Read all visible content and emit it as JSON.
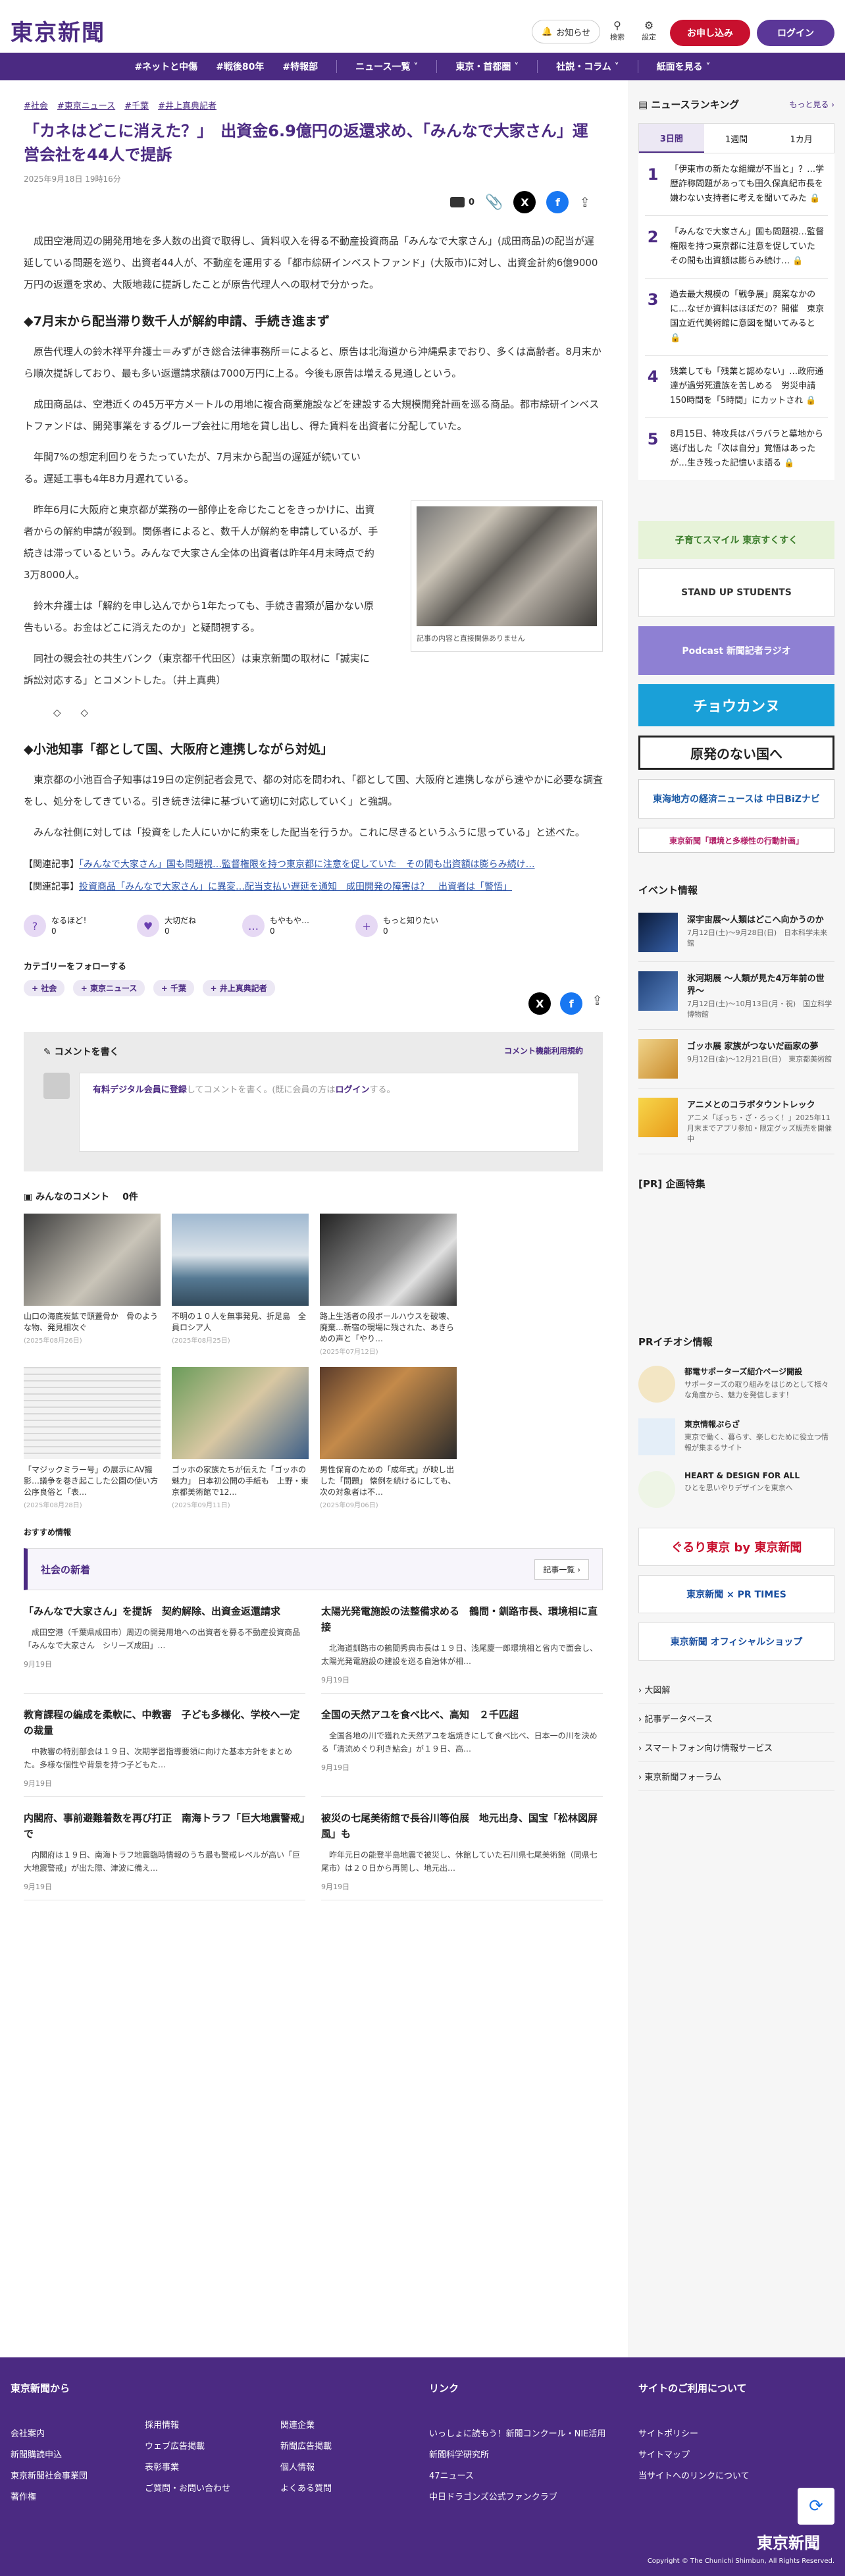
{
  "header": {
    "logo": "東京新聞",
    "notify_label": "お知らせ",
    "search_label": "検索",
    "settings_label": "設定",
    "subscribe_label": "お申し込み",
    "login_label": "ログイン"
  },
  "nav": [
    "#ネットと中傷",
    "#戦後80年",
    "#特報部",
    "ニュース一覧",
    "東京・首都圏",
    "社説・コラム",
    "紙面を見る"
  ],
  "article": {
    "tags": [
      "#社会",
      "#東京ニュース",
      "#千葉",
      "#井上真典記者"
    ],
    "title": "「カネはどこに消えた？」　出資金6.9億円の返還求め、「みんなで大家さん」運営会社を44人で提訴",
    "date": "2025年9月18日 19時16分",
    "save_count": "0",
    "p1": "成田空港周辺の開発用地を多人数の出資で取得し、賃料収入を得る不動産投資商品「みんなで大家さん」(成田商品)の配当が遅延している問題を巡り、出資者44人が、不動産を運用する「都市綜研インベストファンド」(大阪市)に対し、出資金計約6億9000万円の返還を求め、大阪地裁に提訴したことが原告代理人への取材で分かった。",
    "h2a": "◆7月末から配当滞り数千人が解約申請、手続き進まず",
    "p2": "原告代理人の鈴木祥平弁護士＝みずがき総合法律事務所＝によると、原告は北海道から沖縄県までおり、多くは高齢者。8月末から順次提訴しており、最も多い返還請求額は7000万円に上る。今後も原告は増える見通しという。",
    "p3": "成田商品は、空港近くの45万平方メートルの用地に複合商業施設などを建設する大規模開発計画を巡る商品。都市綜研インベストファンドは、開発事業をするグループ会社に用地を貸し出し、得た賃料を出資者に分配していた。",
    "p4": "年間7%の想定利回りをうたっていたが、7月末から配当の遅延が続いている。遅延工事も4年8カ月遅れている。",
    "p5": "昨年6月に大阪府と東京都が業務の一部停止を命じたことをきっかけに、出資者からの解約申請が殺到。関係者によると、数千人が解約を申請しているが、手続きは滞っているという。みんなで大家さん全体の出資者は昨年4月末時点で約3万8000人。",
    "p6": "鈴木弁護士は「解約を申し込んでから1年たっても、手続き書類が届かない原告もいる。お金はどこに消えたのか」と疑問視する。",
    "p7": "同社の親会社の共生バンク（東京都千代田区）は東京新聞の取材に「誠実に訴訟対応する」とコメントした。（井上真典）",
    "marks": "◇　　◇",
    "h2b": "◆小池知事「都として国、大阪府と連携しながら対処」",
    "p8": "東京都の小池百合子知事は19日の定例記者会見で、都の対応を問われ、「都として国、大阪府と連携しながら速やかに必要な調査をし、処分をしてきている。引き続き法律に基づいて適切に対応していく」と強調。",
    "p9": "みんな社側に対しては「投資をした人にいかに約束をした配当を行うか。これに尽きるというふうに思っている」と述べた。",
    "photo_caption": "記事の内容と直接関係ありません",
    "related_label": "【関連記事】",
    "related": [
      "「みんなで大家さん」国も問題視…監督権限を持つ東京都に注意を促していた　その間も出資額は膨らみ続け…",
      "投資商品「みんなで大家さん」に異変…配当支払い遅延を通知　成田開発の障害は？　出資者は「警悟」"
    ],
    "reactions": [
      {
        "label": "なるほど！",
        "count": "0",
        "icon": "?"
      },
      {
        "label": "大切だね",
        "count": "0",
        "icon": "♥"
      },
      {
        "label": "もやもや…",
        "count": "0",
        "icon": "…"
      },
      {
        "label": "もっと知りたい",
        "count": "0",
        "icon": "+"
      }
    ],
    "follow_label": "カテゴリーをフォローする",
    "categories": [
      "社会",
      "東京ニュース",
      "千葉",
      "井上真典記者"
    ]
  },
  "comment_box": {
    "title": "コメントを書く",
    "terms": "コメント機能利用規約",
    "prompt_link": "有料デジタル会員に登録",
    "prompt_mid": "してコメントを書く。(既に会員の方は",
    "prompt_login": "ログイン",
    "prompt_end": "する。"
  },
  "comments": {
    "title": "みんなのコメント",
    "count": "0件"
  },
  "thumbs": [
    {
      "title": "山口の海底炭鉱で頭蓋骨か　骨のような物、発見相次ぐ",
      "date": "(2025年08月26日)"
    },
    {
      "title": "不明の１０人を無事発見、折足島　全員ロシア人",
      "date": "(2025年08月25日)"
    },
    {
      "title": "路上生活者の段ボールハウスを破壊、廃棄…新宿の現場に残された、あきらめの声と「やり…",
      "date": "(2025年07月12日)"
    },
    {
      "title": "「マジックミラー号」の展示にAV撮影…議争を巻き起こした公園の使い方　公序良俗と「表…",
      "date": "(2025年08月28日)"
    },
    {
      "title": "ゴッホの家族たちが伝えた「ゴッホの魅力」 日本初公開の手紙も　上野・東京都美術館で12…",
      "date": "(2025年09月11日)"
    },
    {
      "title": "男性保育のための「成年式」が映し出した「問題」 懐例を続けるにしても、次の対象者は不…",
      "date": "(2025年09月06日)"
    }
  ],
  "recommend_label": "おすすめ情報",
  "news": {
    "title": "社会の新着",
    "more": "記事一覧",
    "items": [
      {
        "title": "「みんなで大家さん」を提訴　契約解除、出資金返還請求",
        "body": "成田空港（千葉県成田市）周辺の開発用地への出資者を募る不動産投資商品「みんなで大家さん　シリーズ成田」…",
        "date": "9月19日"
      },
      {
        "title": "太陽光発電施設の法整備求める　鶴間・釧路市長、環境相に直接",
        "body": "北海道釧路市の鶴間秀典市長は１９日、浅尾慶一郎環境相と省内で面会し、太陽光発電施設の建設を巡る自治体が相…",
        "date": "9月19日"
      },
      {
        "title": "教育課程の編成を柔軟に、中教審　子ども多様化、学校へ一定の裁量",
        "body": "中教審の特別部会は１９日、次期学習指導要領に向けた基本方針をまとめた。多様な個性や背景を持つ子どもた…",
        "date": "9月19日"
      },
      {
        "title": "全国の天然アユを食べ比べ、高知　２千匹超",
        "body": "全国各地の川で獲れた天然アユを塩焼きにして食べ比べ、日本一の川を決める「清流めぐり利き鮎会」が１９日、高…",
        "date": "9月19日"
      },
      {
        "title": "内閣府、事前避難着数を再び打正　南海トラフ「巨大地震警戒」で",
        "body": "内閣府は１９日、南海トラフ地震臨時情報のうち最も警戒レベルが高い「巨大地震警戒」が出た際、津波に備え…",
        "date": "9月19日"
      },
      {
        "title": "被災の七尾美術館で長谷川等伯展　地元出身、国宝「松林図屏風」も",
        "body": "昨年元日の能登半島地震で被災し、休館していた石川県七尾美術館（同県七尾市）は２０日から再開し、地元出…",
        "date": "9月19日"
      }
    ]
  },
  "ranking": {
    "title": "ニュースランキング",
    "more": "もっと見る",
    "tabs": [
      "3日間",
      "1週間",
      "1カ月"
    ],
    "items": [
      "「伊東市の新たな組織が不当と」？…学歴詐称問題があっても田久保真紀市長を嫌わない支持者に考えを聞いてみた",
      "「みんなで大家さん」国も問題視…監督権限を持つ東京都に注意を促していた　その間も出資額は膨らみ続け…",
      "過去最大規模の「戦争展」廃案なかのに…なぜか資料はほぼだの？開催　東京国立近代美術館に意図を聞いてみると",
      "残業しても「残業と認めない」…政府通達が過労死遺族を苦しめる　労災申請150時間を「5時間」にカットされ",
      "8月15日、特攻兵はバラバラと墓地から逃げ出した「次は自分」覚悟はあったが…生き残った記憶いま語る"
    ]
  },
  "banners": [
    "子育てスマイル 東京すくすく",
    "STAND UP STUDENTS",
    "Podcast 新聞記者ラジオ",
    "チョウカンヌ",
    "原発のない国へ",
    "東海地方の経済ニュースは 中日BiZナビ",
    "東京新聞「環境と多様性の行動計画」"
  ],
  "events": {
    "title": "イベント情報",
    "items": [
      {
        "title": "深宇宙展〜人類はどこへ向かうのか",
        "sub": "7月12日(土)〜9月28日(日)　日本科学未来館"
      },
      {
        "title": "氷河期展 〜人類が見た4万年前の世界〜",
        "sub": "7月12日(土)〜10月13日(月・祝)　国立科学博物館"
      },
      {
        "title": "ゴッホ展 家族がつないだ画家の夢",
        "sub": "9月12日(金)〜12月21日(日)　東京都美術館"
      },
      {
        "title": "アニメとのコラボタウントレック",
        "sub": "アニメ「ぼっち・ざ・ろっく！」2025年11月末までアプリ参加・限定グッズ販売を開催中"
      }
    ]
  },
  "pr_title": "[PR] 企画特集",
  "pr_info": {
    "title": "PRイチオシ情報",
    "items": [
      {
        "title": "都電サポーターズ紹介ページ開設",
        "sub": "サポーターズの取り組みをはじめとして様々な角度から、魅力を発信します！"
      },
      {
        "title": "東京情報ぷらざ",
        "sub": "東京で働く、暮らす、楽しむために役立つ情報が集まるサイト"
      },
      {
        "title": "HEART & DESIGN FOR ALL",
        "sub": "ひとを思いやりデザインを東京へ"
      }
    ]
  },
  "side_banners": [
    "ぐるり東京 by 東京新聞",
    "東京新聞 × PR TIMES",
    "東京新聞 オフィシャルショップ"
  ],
  "side_links": [
    "大図解",
    "記事データベース",
    "スマートフォン向け情報サービス",
    "東京新聞フォーラム"
  ],
  "footer": {
    "col1_title": "東京新聞から",
    "col1": [
      "会社案内",
      "新聞購読申込",
      "東京新聞社会事業団",
      "著作権"
    ],
    "col2": [
      "採用情報",
      "ウェブ広告掲載",
      "表彰事業",
      "ご質問・お問い合わせ"
    ],
    "col3": [
      "関連企業",
      "新聞広告掲載",
      "個人情報",
      "よくある質問"
    ],
    "col4_title": "リンク",
    "col4": [
      "いっしょに読もう！新聞コンクール・NIE活用",
      "新聞科学研究所",
      "47ニュース",
      "中日ドラゴンズ公式ファンクラブ"
    ],
    "col5_title": "サイトのご利用について",
    "col5": [
      "サイトポリシー",
      "サイトマップ",
      "当サイトへのリンクについて"
    ],
    "logo": "東京新聞",
    "copyright": "Copyright © The Chunichi Shimbun, All Rights Reserved."
  },
  "colors": {
    "brand": "#4b2a82",
    "subscribe": "#c8102e"
  }
}
